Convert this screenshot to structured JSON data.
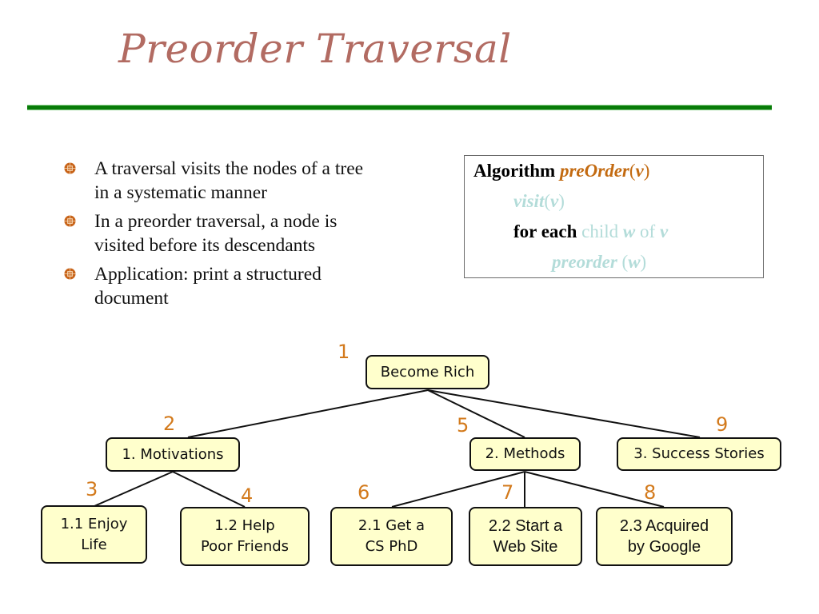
{
  "slide": {
    "title": "Preorder Traversal",
    "bullets": [
      {
        "line1": "A traversal visits the nodes of a tree",
        "line2": "in a systematic manner"
      },
      {
        "line1": "In a preorder traversal, a node is",
        "line2": "visited before its descendants"
      },
      {
        "line1": "Application: print a structured",
        "line2": "document"
      }
    ],
    "algorithm": {
      "keyword": "Algorithm",
      "name": "preOrder",
      "open": "(",
      "param": "v",
      "close": ")",
      "visit_fn": "visit",
      "visit_open": "(",
      "visit_param": "v",
      "visit_close": ")",
      "for_each": "for each",
      "child_text": "child",
      "child_var": "w",
      "of_text": "of",
      "of_var": "v",
      "recurse_fn": "preorder",
      "recurse_open": "(",
      "recurse_param": "w",
      "recurse_close": ")"
    },
    "colors": {
      "title": "#b26b62",
      "rule": "#087b08",
      "bullet": "#c8641a",
      "algo_name": "#c36a10",
      "algo_faded": "#b3dcd9",
      "node_fill": "#ffffcc",
      "order_number": "#d37a1c"
    }
  },
  "tree": {
    "nodes": [
      {
        "id": "root",
        "label": "Become Rich",
        "order": "1"
      },
      {
        "id": "n1",
        "label": "1. Motivations",
        "order": "2"
      },
      {
        "id": "n11",
        "label_line1": "1.1 Enjoy",
        "label_line2": "Life",
        "order": "3"
      },
      {
        "id": "n12",
        "label_line1": "1.2 Help",
        "label_line2": "Poor Friends",
        "order": "4"
      },
      {
        "id": "n2",
        "label": "2. Methods",
        "order": "5"
      },
      {
        "id": "n21",
        "label_line1": "2.1 Get a",
        "label_line2": "CS PhD",
        "order": "6"
      },
      {
        "id": "n22",
        "label_line1": "2.2 Start a",
        "label_line2": "Web Site",
        "order": "7"
      },
      {
        "id": "n23",
        "label_line1": "2.3 Acquired",
        "label_line2": "by Google",
        "order": "8"
      },
      {
        "id": "n3",
        "label": "3. Success Stories",
        "order": "9"
      }
    ],
    "edges": [
      [
        "root",
        "n1"
      ],
      [
        "root",
        "n2"
      ],
      [
        "root",
        "n3"
      ],
      [
        "n1",
        "n11"
      ],
      [
        "n1",
        "n12"
      ],
      [
        "n2",
        "n21"
      ],
      [
        "n2",
        "n22"
      ],
      [
        "n2",
        "n23"
      ]
    ]
  }
}
